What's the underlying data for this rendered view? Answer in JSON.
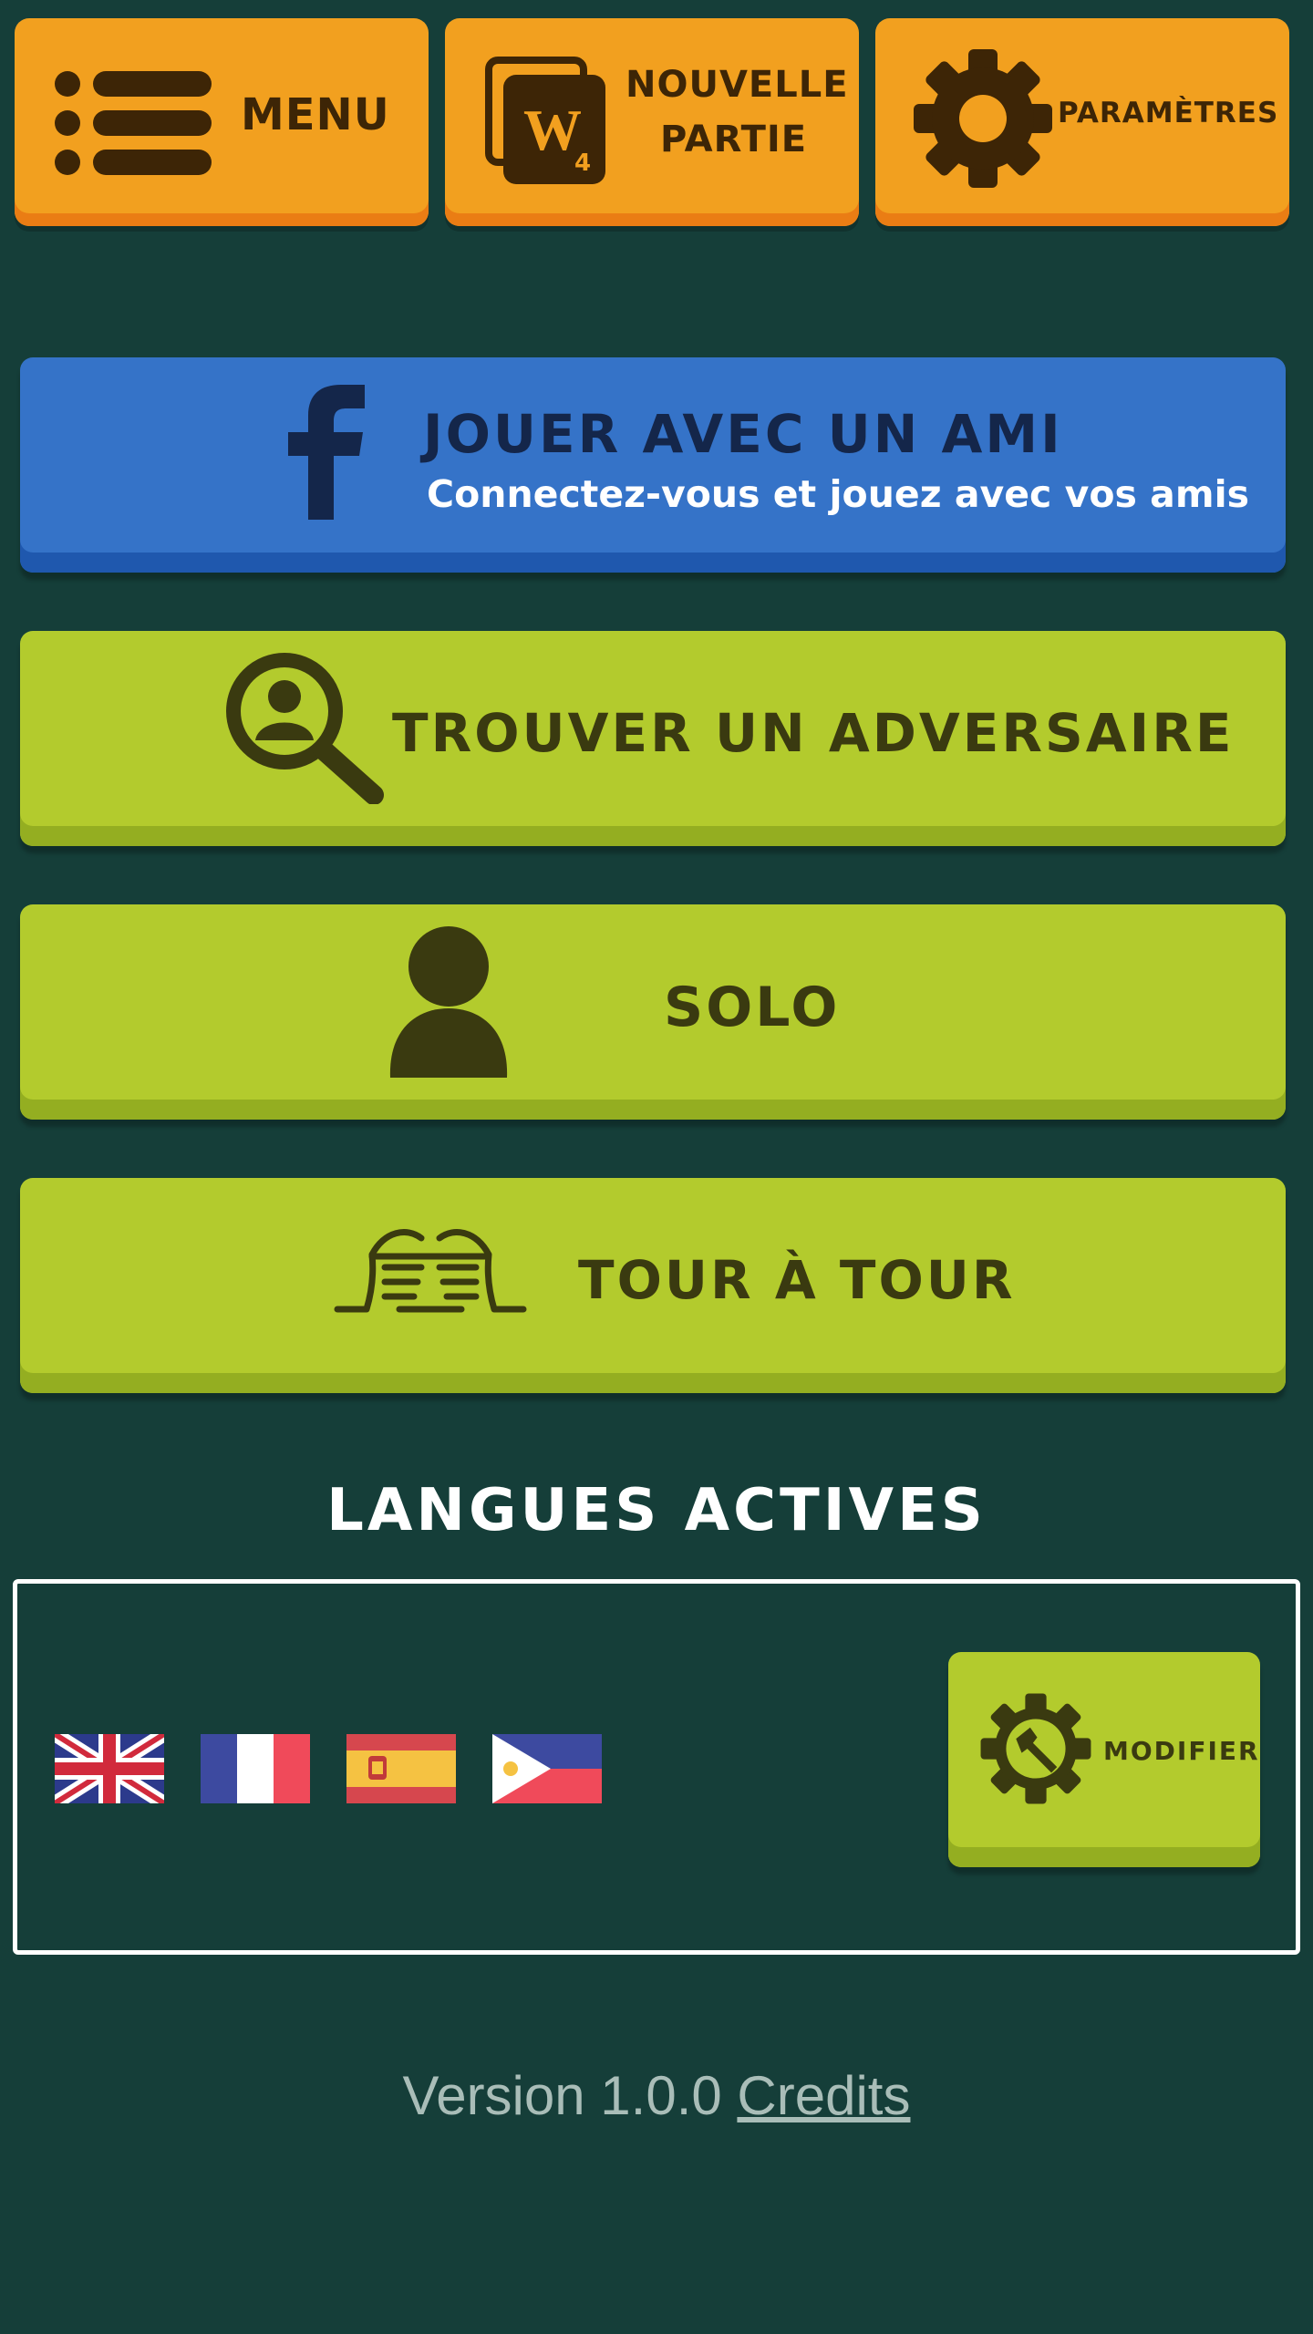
{
  "toolbar": {
    "menu_label": "MENU",
    "new_game_line1": "NOUVELLE",
    "new_game_line2": "PARTIE",
    "new_game_icon_letter": "W",
    "new_game_icon_sub": "4",
    "settings_label": "PARAMÈTRES"
  },
  "actions": {
    "friend_title": "JOUER AVEC UN AMI",
    "friend_subtitle": "Connectez-vous et jouez avec vos amis",
    "find_opponent": "TROUVER UN ADVERSAIRE",
    "solo": "SOLO",
    "turn_based": "TOUR À TOUR"
  },
  "languages": {
    "heading": "LANGUES ACTIVES",
    "flags": [
      "uk-flag-icon",
      "france-flag-icon",
      "spain-flag-icon",
      "philippines-flag-icon"
    ],
    "modify_label": "MODIFIER"
  },
  "footer": {
    "version_text": "Version 1.0.0",
    "credits_link": "Credits"
  },
  "colors": {
    "background": "#153e39",
    "orange": "#f2a01f",
    "green": "#b3cb2d",
    "blue": "#3573c8"
  }
}
